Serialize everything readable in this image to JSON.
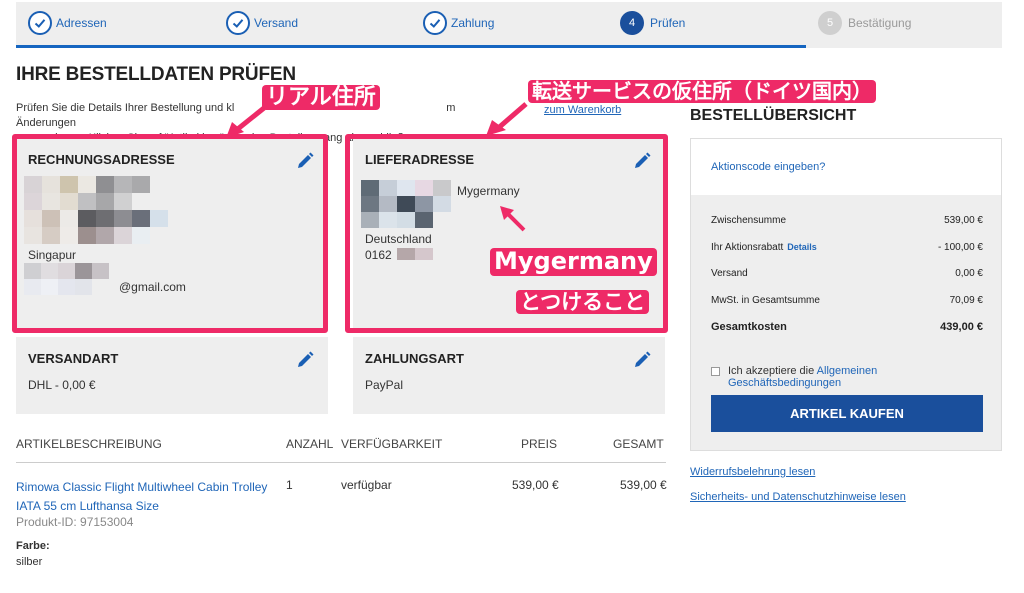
{
  "stepper": {
    "steps": [
      {
        "label": "Adressen",
        "state": "done"
      },
      {
        "label": "Versand",
        "state": "done"
      },
      {
        "label": "Zahlung",
        "state": "done"
      },
      {
        "label": "Prüfen",
        "number": "4",
        "state": "active"
      },
      {
        "label": "Bestätigung",
        "number": "5",
        "state": "todo"
      }
    ]
  },
  "page": {
    "title": "IHRE BESTELLDATEN PRÜFEN",
    "intro_line1": "Prüfen Sie die Details Ihrer Bestellung und kl",
    "intro_line1_end": "m Änderungen",
    "intro_line2": "vorzunehmen. Klicken Sie auf \"Artikel kau",
    "intro_line2_end": "\", um den Bestellvorgang abzuschließen.",
    "intro_link": "zum Warenkorb"
  },
  "billing": {
    "heading": "RECHNUNGSADRESSE",
    "country": "Singapur",
    "email_suffix": "@gmail.com"
  },
  "shipping": {
    "heading": "LIEFERADRESSE",
    "company": "Mygermany",
    "country": "Deutschland",
    "phone_prefix": "0162"
  },
  "shipping_method": {
    "heading": "VERSANDART",
    "value": "DHL  -  0,00 €"
  },
  "payment": {
    "heading": "ZAHLUNGSART",
    "value": "PayPal"
  },
  "table": {
    "headers": {
      "description": "ARTIKELBESCHREIBUNG",
      "quantity": "ANZAHL",
      "availability": "VERFÜGBARKEIT",
      "price": "PREIS",
      "total": "GESAMT"
    },
    "item": {
      "name": "Rimowa Classic Flight Multiwheel Cabin Trolley IATA 55 cm Lufthansa Size",
      "product_id": "Produkt-ID: 97153004",
      "quantity": "1",
      "availability": "verfügbar",
      "price": "539,00 €",
      "total": "539,00 €",
      "color_label": "Farbe:",
      "color_value": "silber"
    }
  },
  "summary": {
    "title": "BESTELLÜBERSICHT",
    "promo_link": "Aktionscode eingeben?",
    "rows": [
      {
        "label": "Zwischensumme",
        "value": "539,00 €"
      },
      {
        "label": "Ihr Aktionsrabatt",
        "details": "Details",
        "value": "- 100,00 €"
      },
      {
        "label": "Versand",
        "value": "0,00 €"
      },
      {
        "label": "MwSt. in Gesamtsumme",
        "value": "70,09 €"
      }
    ],
    "total_label": "Gesamtkosten",
    "total_value": "439,00 €",
    "agb_prefix": "Ich akzeptiere die ",
    "agb_link1": "Allgemeinen",
    "agb_link2": "Geschäftsbedingungen",
    "buy_button": "ARTIKEL KAUFEN",
    "link_revocation": "Widerrufsbelehrung lesen",
    "link_privacy": "Sicherheits- und Datenschutzhinweise lesen"
  },
  "annotations": {
    "real_address": "リアル住所",
    "forwarding_address": "転送サービスの仮住所（ドイツ国内）",
    "mygermany_line1": "Mygermany",
    "mygermany_line2": "とつけること"
  },
  "colors": {
    "accent": "#1a4f9c",
    "link": "#2066b8",
    "annotation": "#ee2a67",
    "panel": "#eeeeee"
  }
}
